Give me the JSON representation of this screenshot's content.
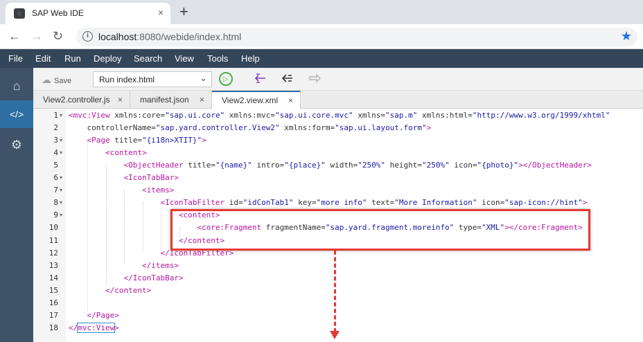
{
  "browser": {
    "tab_title": "SAP Web IDE",
    "tab_close": "×",
    "new_tab": "+",
    "url_host": "localhost",
    "url_rest": ":8080/webide/index.html",
    "back": "←",
    "forward": "→",
    "reload": "↻",
    "info": "i",
    "star": "★"
  },
  "menu": {
    "items": [
      "File",
      "Edit",
      "Run",
      "Deploy",
      "Search",
      "View",
      "Tools",
      "Help"
    ]
  },
  "sidebar": {
    "home": "⌂",
    "code": "</>",
    "settings": "⚙"
  },
  "toolbar": {
    "save_label": "Save",
    "run_select_value": "Run index.html",
    "chevron": "⌄",
    "run_icon": "▷"
  },
  "editor_tabs": [
    {
      "label": "View2.controller.js",
      "close": "×"
    },
    {
      "label": "manifest.json",
      "close": "×"
    },
    {
      "label": "View2.view.xml",
      "close": "×"
    }
  ],
  "code": {
    "line_numbers": [
      "1",
      "2",
      "3",
      "4",
      "5",
      "6",
      "7",
      "8",
      "9",
      "10",
      "11",
      "12",
      "13",
      "14",
      "15",
      "16",
      "17",
      "18"
    ],
    "folds": [
      "▾",
      "",
      "▾",
      "▾",
      "",
      "▾",
      "▾",
      "▾",
      "▾",
      "",
      "",
      "",
      "",
      "",
      "",
      "",
      "",
      ""
    ],
    "lines": [
      [
        {
          "t": "<mvc:View",
          "c": "t"
        },
        {
          "t": " xmlns:core=",
          "c": "a"
        },
        {
          "t": "\"sap.ui.core\"",
          "c": "v"
        },
        {
          "t": " xmlns:mvc=",
          "c": "a"
        },
        {
          "t": "\"sap.ui.core.mvc\"",
          "c": "v"
        },
        {
          "t": " xmlns=",
          "c": "a"
        },
        {
          "t": "\"sap.m\"",
          "c": "v"
        },
        {
          "t": " xmlns:html=",
          "c": "a"
        },
        {
          "t": "\"http://www.w3.org/1999/xhtml\"",
          "c": "v"
        }
      ],
      [
        {
          "t": "    controllerName=",
          "c": "a"
        },
        {
          "t": "\"sap.yard.controller.View2\"",
          "c": "v"
        },
        {
          "t": " xmlns:form=",
          "c": "a"
        },
        {
          "t": "\"sap.ui.layout.form\"",
          "c": "v"
        },
        {
          "t": ">",
          "c": "t"
        }
      ],
      [
        {
          "t": "    <Page",
          "c": "t"
        },
        {
          "t": " title=",
          "c": "a"
        },
        {
          "t": "\"{i18n>XTIT}\"",
          "c": "v"
        },
        {
          "t": ">",
          "c": "t"
        }
      ],
      [
        {
          "t": "        <content>",
          "c": "t"
        }
      ],
      [
        {
          "t": "            <ObjectHeader",
          "c": "t"
        },
        {
          "t": " title=",
          "c": "a"
        },
        {
          "t": "\"{name}\"",
          "c": "v"
        },
        {
          "t": " intro=",
          "c": "a"
        },
        {
          "t": "\"{place}\"",
          "c": "v"
        },
        {
          "t": " width=",
          "c": "a"
        },
        {
          "t": "\"250%\"",
          "c": "v"
        },
        {
          "t": " height=",
          "c": "a"
        },
        {
          "t": "\"250%\"",
          "c": "v"
        },
        {
          "t": " icon=",
          "c": "a"
        },
        {
          "t": "\"{photo}\"",
          "c": "v"
        },
        {
          "t": "></ObjectHeader>",
          "c": "t"
        }
      ],
      [
        {
          "t": "            <IconTabBar>",
          "c": "t"
        }
      ],
      [
        {
          "t": "                <items>",
          "c": "t"
        }
      ],
      [
        {
          "t": "                    <IconTabFilter",
          "c": "t"
        },
        {
          "t": " id=",
          "c": "a"
        },
        {
          "t": "\"idConTab1\"",
          "c": "v"
        },
        {
          "t": " key=",
          "c": "a"
        },
        {
          "t": "\"more info\"",
          "c": "v"
        },
        {
          "t": " text=",
          "c": "a"
        },
        {
          "t": "\"More Information\"",
          "c": "v"
        },
        {
          "t": " icon=",
          "c": "a"
        },
        {
          "t": "\"sap-icon://hint\"",
          "c": "v"
        },
        {
          "t": ">",
          "c": "t"
        }
      ],
      [
        {
          "t": "                        <content>",
          "c": "t"
        }
      ],
      [
        {
          "t": "                            <core:Fragment",
          "c": "t"
        },
        {
          "t": " fragmentName=",
          "c": "a"
        },
        {
          "t": "\"sap.yard.fragment.moreinfo\"",
          "c": "v"
        },
        {
          "t": " type=",
          "c": "a"
        },
        {
          "t": "\"XML\"",
          "c": "v"
        },
        {
          "t": "></core:Fragment>",
          "c": "t"
        }
      ],
      [
        {
          "t": "                        </content>",
          "c": "t"
        }
      ],
      [
        {
          "t": "                    </IconTabFilter>",
          "c": "t"
        }
      ],
      [
        {
          "t": "                </items>",
          "c": "t"
        }
      ],
      [
        {
          "t": "            </IconTabBar>",
          "c": "t"
        }
      ],
      [
        {
          "t": "        </content>",
          "c": "t"
        }
      ],
      [
        {
          "t": "",
          "c": "p"
        }
      ],
      [
        {
          "t": "    </Page>",
          "c": "t"
        }
      ],
      [
        {
          "t": "</",
          "c": "t"
        },
        {
          "t": "mvc:View",
          "c": "t",
          "cursor": true
        },
        {
          "t": ">",
          "c": "t"
        }
      ]
    ]
  }
}
